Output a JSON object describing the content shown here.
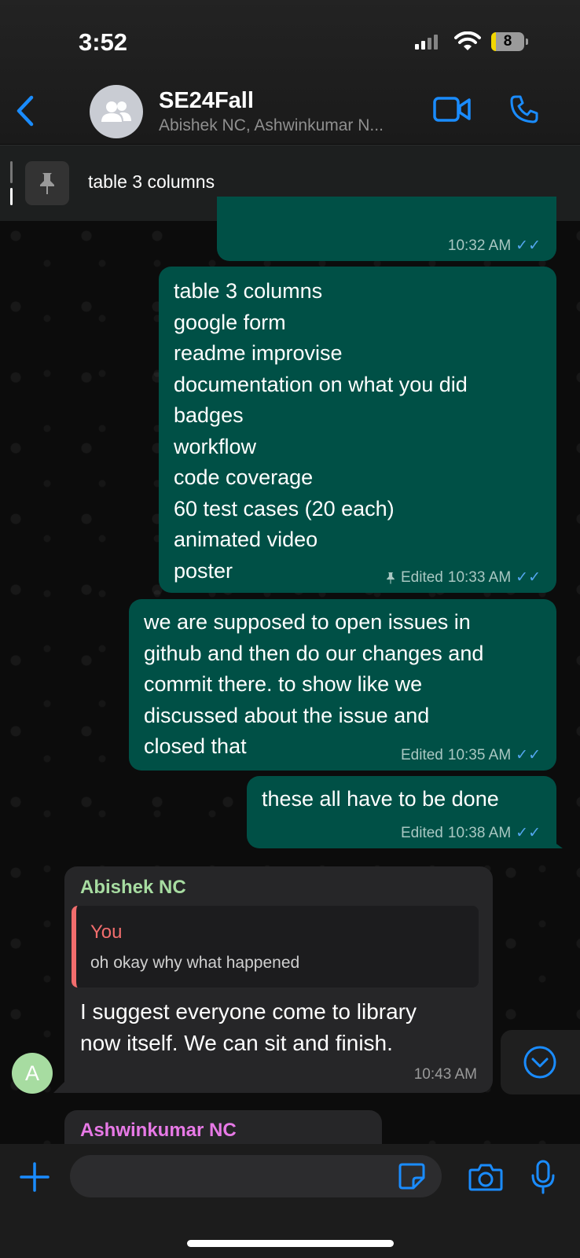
{
  "status_bar": {
    "time": "3:52",
    "battery": "8"
  },
  "header": {
    "title": "SE24Fall",
    "subtitle": "Abishek NC, Ashwinkumar N..."
  },
  "pinned": {
    "text": "table 3 columns"
  },
  "messages": {
    "m0": {
      "time": "10:32 AM"
    },
    "m1": {
      "lines": [
        "table 3 columns",
        "google form",
        "readme improvise",
        "documentation on what you did",
        "badges",
        "workflow",
        "code coverage",
        "60 test cases (20 each)",
        "animated video",
        "poster"
      ],
      "edited": "Edited",
      "time": "10:33 AM"
    },
    "m2": {
      "lines": [
        "we are supposed to open issues in",
        "github and then do our changes and",
        "commit there. to show like we",
        "discussed about the issue and",
        "closed that"
      ],
      "edited": "Edited",
      "time": "10:35 AM"
    },
    "m3": {
      "text": "these all have to be done",
      "edited": "Edited",
      "time": "10:38 AM"
    },
    "m4": {
      "sender": "Abishek NC",
      "quote_author": "You",
      "quote_text": "oh okay why what happened",
      "lines": [
        "I suggest everyone come to library",
        "now itself. We can sit and finish."
      ],
      "time": "10:43 AM",
      "avatar_letter": "A"
    },
    "m5": {
      "sender": "Ashwinkumar NC"
    }
  },
  "colors": {
    "accent": "#1a8cff",
    "outgoing_bubble": "#005046",
    "incoming_bubble": "#262628",
    "sender_abishek": "#a7dca1",
    "sender_ashwin": "#e779e6",
    "quote_author": "#f26d6d"
  }
}
